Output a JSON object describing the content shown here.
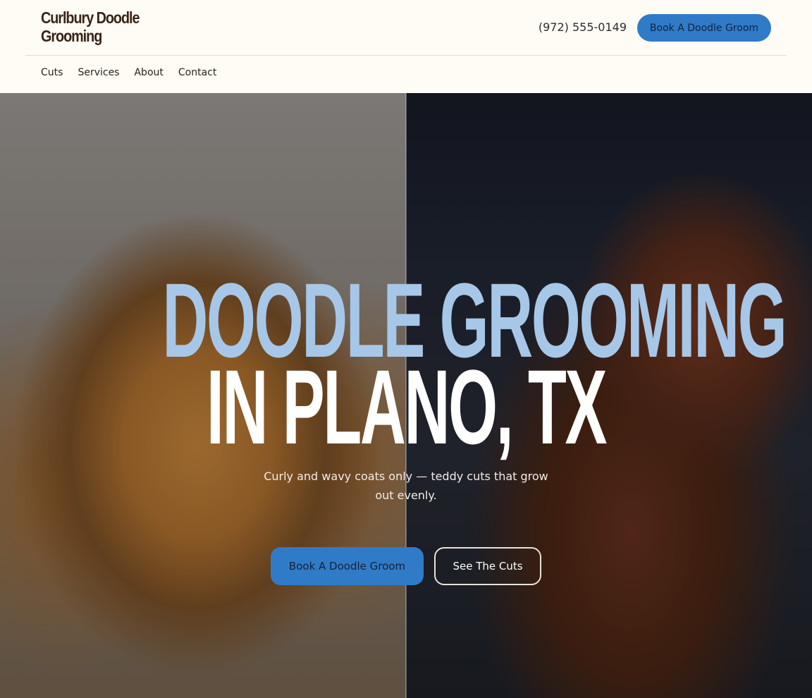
{
  "header": {
    "brand": "Curlbury Doodle Grooming",
    "phone": "(972) 555-0149",
    "cta_label": "Book A Doodle Groom"
  },
  "nav": {
    "items": [
      {
        "label": "Cuts"
      },
      {
        "label": "Services"
      },
      {
        "label": "About"
      },
      {
        "label": "Contact"
      }
    ]
  },
  "hero": {
    "title_line1": "DOODLE GROOMING",
    "title_line2": "IN PLANO, TX",
    "subtitle": "Curly and wavy coats only — teddy cuts that grow out evenly.",
    "primary_cta": "Book A Doodle Groom",
    "secondary_cta": "See The Cuts"
  },
  "colors": {
    "accent": "#2f7bc8",
    "title_blue": "#a6c7e8",
    "brand_brown": "#3a2414"
  }
}
